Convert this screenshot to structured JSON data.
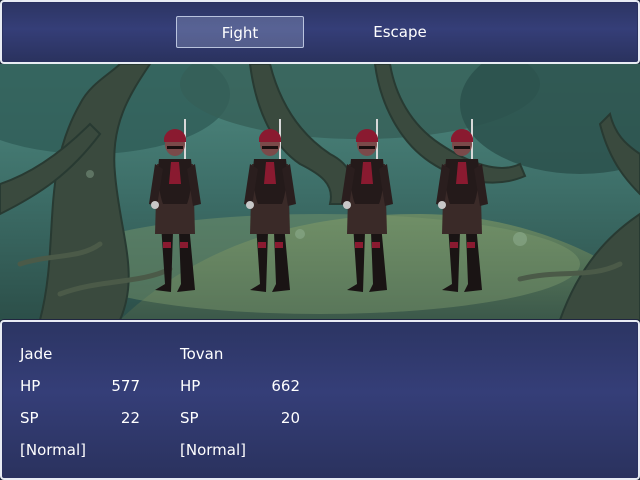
{
  "commands": {
    "fight_label": "Fight",
    "escape_label": "Escape"
  },
  "party": [
    {
      "name": "Jade",
      "hp_label": "HP",
      "hp": "577",
      "sp_label": "SP",
      "sp": "22",
      "status": "[Normal]"
    },
    {
      "name": "Tovan",
      "hp_label": "HP",
      "hp": "662",
      "sp_label": "SP",
      "sp": "20",
      "status": "[Normal]"
    }
  ],
  "enemies": [
    {
      "sprite": "bandit-sprite"
    },
    {
      "sprite": "bandit-sprite"
    },
    {
      "sprite": "bandit-sprite"
    },
    {
      "sprite": "bandit-sprite"
    }
  ],
  "colors": {
    "window_bg": "#353e78",
    "window_border": "#e8ecf4",
    "forest_bg": "#2f5450",
    "enemy_cloth": "#3a2a28",
    "enemy_accent": "#8a1a30"
  }
}
